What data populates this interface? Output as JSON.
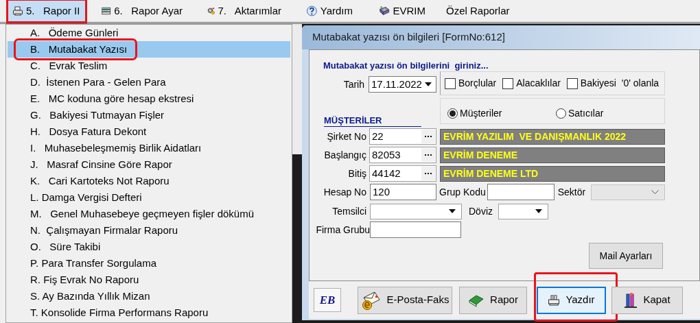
{
  "menu_bar": [
    {
      "label": "5.   Rapor II",
      "selected": true,
      "highlighted": true
    },
    {
      "label": "6.   Rapor Ayar",
      "selected": false,
      "highlighted": false
    },
    {
      "label": "7.   Aktarımlar",
      "selected": false,
      "highlighted": false
    },
    {
      "label": "Yardım",
      "selected": false,
      "highlighted": false
    },
    {
      "label": "EVRIM",
      "selected": false,
      "highlighted": false
    },
    {
      "label": "Özel Raporlar",
      "selected": false,
      "highlighted": false
    }
  ],
  "dropdown": {
    "items": [
      {
        "label": "A.   Ödeme Günleri",
        "selected": false,
        "highlighted": false
      },
      {
        "label": "B.   Mutabakat Yazısı",
        "selected": true,
        "highlighted": true
      },
      {
        "label": "C.   Evrak Teslim",
        "selected": false,
        "highlighted": false
      },
      {
        "label": "D.  İstenen Para - Gelen Para",
        "selected": false,
        "highlighted": false
      },
      {
        "label": "E.   MC koduna göre hesap ekstresi",
        "selected": false,
        "highlighted": false
      },
      {
        "label": "G.   Bakiyesi Tutmayan Fişler",
        "selected": false,
        "highlighted": false
      },
      {
        "label": "H.   Dosya Fatura Dekont",
        "selected": false,
        "highlighted": false
      },
      {
        "label": "I.   Muhasebeleşmemiş Birlik Aidatları",
        "selected": false,
        "highlighted": false
      },
      {
        "label": "J.   Masraf Cinsine Göre Rapor",
        "selected": false,
        "highlighted": false
      },
      {
        "label": "K.   Cari Kartoteks Not Raporu",
        "selected": false,
        "highlighted": false
      },
      {
        "label": "L. Damga Vergisi Defteri",
        "selected": false,
        "highlighted": false
      },
      {
        "label": "M.   Genel Muhasebeye geçmeyen fişler dökümü",
        "selected": false,
        "highlighted": false
      },
      {
        "label": "N.  Çalışmayan Firmalar Raporu",
        "selected": false,
        "highlighted": false
      },
      {
        "label": "O.   Süre Takibi",
        "selected": false,
        "highlighted": false
      },
      {
        "label": "P. Para Transfer Sorgulama",
        "selected": false,
        "highlighted": false
      },
      {
        "label": "R. Fiş Evrak No Raporu",
        "selected": false,
        "highlighted": false
      },
      {
        "label": "S. Ay Bazında Yıllık Mizan",
        "selected": false,
        "highlighted": false
      },
      {
        "label": "T. Konsolide Firma Performans Raporu",
        "selected": false,
        "highlighted": false
      }
    ]
  },
  "dialog": {
    "title": "Mutabakat yazısı ön bilgileri [FormNo:612]",
    "heading": "Mutabakat yazısı ön bilgilerini  giriniz...",
    "date": {
      "label": "Tarih",
      "value": "17.11.2022"
    },
    "checkboxes": [
      {
        "label": "Borçlular",
        "checked": false
      },
      {
        "label": "Alacaklılar",
        "checked": false
      },
      {
        "label": "Bakiyesi  '0' olanla",
        "checked": false
      }
    ],
    "radios": [
      {
        "label": "Müşteriler",
        "selected": true
      },
      {
        "label": "Satıcılar",
        "selected": false
      }
    ],
    "section_title": "MÜŞTERİLER",
    "lookups": [
      {
        "label": "Şirket No",
        "value": "22",
        "name": "EVRİM YAZILIM  VE DANIŞMANLIK 2022"
      },
      {
        "label": "Başlangıç",
        "value": "82053",
        "name": "EVRİM DENEME"
      },
      {
        "label": "Bitiş",
        "value": "44142",
        "name": "EVRİM DENEME LTD"
      }
    ],
    "hesap_no": {
      "label": "Hesap No",
      "value": "120"
    },
    "grup_kodu": {
      "label": "Grup Kodu"
    },
    "sektor": {
      "label": "Sektör",
      "disabled": true
    },
    "temsilci": {
      "label": "Temsilci"
    },
    "doviz": {
      "label": "Döviz"
    },
    "firma_grubu": {
      "label": "Firma Grubu"
    },
    "mail_button": "Mail Ayarları",
    "logo": "EB",
    "buttons": [
      {
        "label": "E-Posta-Faks",
        "focused": false,
        "highlighted": false
      },
      {
        "label": "Rapor",
        "focused": false,
        "highlighted": false
      },
      {
        "label": "Yazdır",
        "focused": true,
        "highlighted": true
      },
      {
        "label": "Kapat",
        "focused": false,
        "highlighted": false
      }
    ]
  }
}
